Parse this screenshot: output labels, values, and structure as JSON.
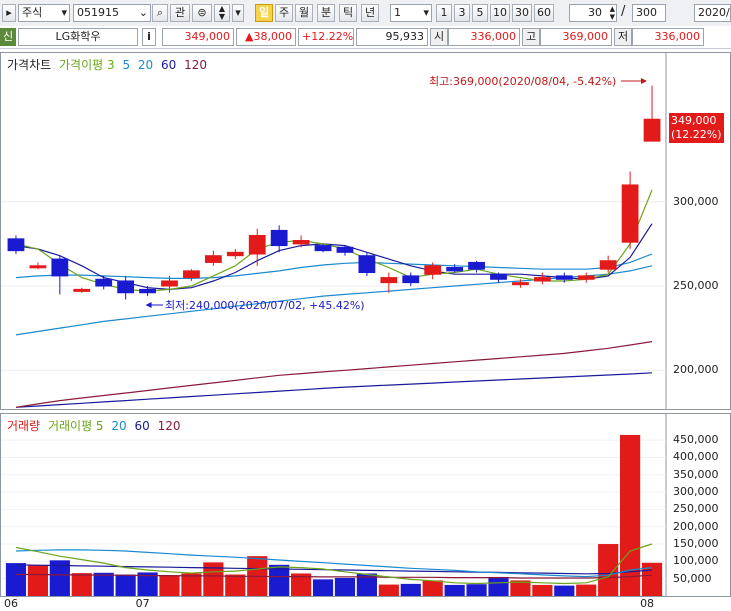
{
  "toolbar": {
    "market": "주식",
    "code": "051915",
    "watch_label": "관",
    "period_selected": "일",
    "periods": [
      "주",
      "월",
      "분",
      "틱",
      "년"
    ],
    "interval": "1",
    "intervals": [
      "1",
      "3",
      "5",
      "10",
      "30",
      "60"
    ],
    "count": "30",
    "total": "300",
    "date": "2020/0"
  },
  "quote": {
    "badge": "신",
    "name": "LG화학우",
    "info": "i",
    "price": "349,000",
    "change": "▲38,000",
    "change_pct": "+12.22%",
    "volume": "95,933",
    "open_label": "시",
    "open": "336,000",
    "high_label": "고",
    "high": "369,000",
    "low_label": "저",
    "low": "336,000"
  },
  "colors": {
    "up": "#e21a1a",
    "down": "#1a1ad0",
    "ma5": "#6aa51a",
    "ma20": "#1a8ad0",
    "ma60": "#1a1a9a",
    "ma120": "#8a1a3a"
  },
  "chart_data": [
    {
      "type": "candlestick",
      "title": "가격차트",
      "legend": [
        {
          "text": "가격이평 3",
          "color": "#6aa51a"
        },
        {
          "text": "5",
          "color": "#1a8ad0"
        },
        {
          "text": "20",
          "color": "#1a8ad0"
        },
        {
          "text": "60",
          "color": "#1a1a9a"
        },
        {
          "text": "120",
          "color": "#8a1a3a"
        }
      ],
      "ylim": [
        177000,
        380000
      ],
      "yticks": [
        200000,
        250000,
        300000
      ],
      "ytick_labels": [
        "200,000",
        "250,000",
        "300,000"
      ],
      "x_labels": [
        {
          "index": 0,
          "text": "06"
        },
        {
          "index": 6,
          "text": "07"
        },
        {
          "index": 29,
          "text": "08"
        }
      ],
      "candles": [
        [
          278000,
          280000,
          269000,
          271000
        ],
        [
          262000,
          264000,
          260000,
          262000
        ],
        [
          266000,
          268000,
          245000,
          256000
        ],
        [
          248000,
          249000,
          246000,
          248000
        ],
        [
          254000,
          256000,
          248000,
          250000
        ],
        [
          253000,
          256000,
          242000,
          246000
        ],
        [
          248000,
          250000,
          244000,
          246000
        ],
        [
          250000,
          256000,
          246000,
          253000
        ],
        [
          255000,
          260000,
          253000,
          259000
        ],
        [
          264000,
          271000,
          262000,
          268000
        ],
        [
          268000,
          272000,
          266000,
          270000
        ],
        [
          269000,
          284000,
          262000,
          280000
        ],
        [
          283000,
          286000,
          270000,
          274000
        ],
        [
          275000,
          280000,
          273000,
          277000
        ],
        [
          274000,
          275000,
          270000,
          271000
        ],
        [
          273000,
          274000,
          268000,
          270000
        ],
        [
          268000,
          270000,
          256000,
          258000
        ],
        [
          252000,
          258000,
          246000,
          255000
        ],
        [
          256000,
          258000,
          250000,
          252000
        ],
        [
          257000,
          264000,
          254000,
          262000
        ],
        [
          261000,
          263000,
          258000,
          259000
        ],
        [
          264000,
          265000,
          258000,
          260000
        ],
        [
          257000,
          258000,
          252000,
          254000
        ],
        [
          251000,
          254000,
          249000,
          252000
        ],
        [
          253000,
          258000,
          251000,
          255000
        ],
        [
          256000,
          258000,
          252000,
          254000
        ],
        [
          254000,
          258000,
          252000,
          256000
        ],
        [
          260000,
          268000,
          258000,
          265000
        ],
        [
          276000,
          318000,
          272000,
          310000
        ],
        [
          336000,
          369000,
          336000,
          349000
        ]
      ],
      "ma3": [
        275000,
        272000,
        263000,
        255000,
        251000,
        248000,
        247000,
        248000,
        250000,
        256000,
        262000,
        272000,
        276000,
        277000,
        275000,
        272000,
        266000,
        261000,
        255000,
        257000,
        258000,
        260000,
        257000,
        255000,
        253000,
        253000,
        254000,
        257000,
        275000,
        307000
      ],
      "ma5": [
        274000,
        272000,
        268000,
        262000,
        255000,
        252000,
        249000,
        248000,
        249000,
        253000,
        258000,
        265000,
        271000,
        274000,
        275000,
        274000,
        270000,
        266000,
        262000,
        259000,
        257000,
        257000,
        257000,
        257000,
        256000,
        255000,
        254000,
        256000,
        267000,
        287000
      ],
      "ma20": [
        255000,
        256000,
        256500,
        256500,
        256000,
        255500,
        255000,
        254500,
        254500,
        255000,
        256000,
        257500,
        259000,
        261000,
        262500,
        263500,
        264000,
        263500,
        263000,
        262500,
        262000,
        261500,
        261000,
        260500,
        260000,
        260000,
        260000,
        261000,
        264000,
        269000
      ],
      "ma60": [
        221000,
        223000,
        225000,
        227000,
        229000,
        230500,
        232000,
        233500,
        235000,
        236500,
        238000,
        239500,
        241000,
        242500,
        244000,
        245000,
        246000,
        247000,
        248000,
        249000,
        250000,
        251000,
        252000,
        253000,
        254000,
        255000,
        256000,
        257000,
        259000,
        262000
      ],
      "ma120": [
        178000,
        180000,
        182000,
        183500,
        185000,
        186500,
        188000,
        189500,
        191000,
        192500,
        194000,
        195500,
        197000,
        198000,
        199000,
        200000,
        201000,
        202000,
        203000,
        204000,
        205000,
        206000,
        207000,
        208000,
        209000,
        210000,
        211500,
        213000,
        215000,
        217000
      ],
      "ma120_b": [
        178000,
        178800,
        179600,
        180400,
        181200,
        182000,
        182800,
        183600,
        184400,
        185200,
        186000,
        186800,
        187600,
        188400,
        189200,
        190000,
        190600,
        191200,
        191800,
        192400,
        193000,
        193600,
        194200,
        194800,
        195400,
        196000,
        196600,
        197200,
        197800,
        198500
      ],
      "annotations": {
        "high": "최고:369,000(2020/08/04, -5.42%)",
        "low": "최저:240,000(2020/07/02, +45.42%)",
        "last_price": "349,000",
        "last_pct": "(12.22%)"
      }
    },
    {
      "type": "bar",
      "title": "거래량",
      "legend": [
        {
          "text": "거래이평 5",
          "color": "#6aa51a"
        },
        {
          "text": "20",
          "color": "#1a8ad0"
        },
        {
          "text": "60",
          "color": "#1a1a9a"
        },
        {
          "text": "120",
          "color": "#8a1a3a"
        }
      ],
      "ylim": [
        0,
        485000
      ],
      "yticks": [
        50000,
        100000,
        150000,
        200000,
        250000,
        300000,
        350000,
        400000,
        450000
      ],
      "ytick_labels": [
        "50,000",
        "100,000",
        "150,000",
        "200,000",
        "250,000",
        "300,000",
        "350,000",
        "400,000",
        "450,000"
      ],
      "volumes": [
        95000,
        88000,
        103000,
        66000,
        67000,
        62000,
        68000,
        58000,
        65000,
        97000,
        62000,
        115000,
        90000,
        65000,
        48000,
        52000,
        65000,
        33000,
        35000,
        45000,
        32000,
        34000,
        55000,
        45000,
        32000,
        30000,
        33000,
        150000,
        465000,
        95933
      ],
      "vma5": [
        140000,
        128000,
        115000,
        105000,
        95000,
        82000,
        75000,
        70000,
        66000,
        70000,
        72000,
        78000,
        84000,
        82000,
        78000,
        70000,
        62000,
        55000,
        48000,
        44000,
        38000,
        36000,
        38000,
        40000,
        38000,
        36000,
        38000,
        55000,
        130000,
        150000
      ],
      "vma20": [
        130000,
        132000,
        133000,
        133000,
        132000,
        130000,
        126000,
        122000,
        118000,
        115000,
        112000,
        108000,
        104000,
        100000,
        96000,
        92000,
        88000,
        84000,
        80000,
        77000,
        74000,
        70000,
        67000,
        64000,
        61000,
        58000,
        56000,
        60000,
        75000,
        82000
      ],
      "vma60": [
        90000,
        89000,
        88000,
        87000,
        86000,
        85000,
        84000,
        83000,
        82000,
        81000,
        80000,
        79000,
        78000,
        77000,
        76000,
        75000,
        74000,
        73000,
        72000,
        71000,
        70000,
        69000,
        68000,
        67000,
        66000,
        65000,
        64000,
        65000,
        70000,
        75000
      ],
      "vma120": [
        62000,
        62000,
        61000,
        61000,
        60000,
        60000,
        59000,
        59000,
        58000,
        58000,
        57000,
        57000,
        56000,
        56000,
        55000,
        55000,
        55000,
        54000,
        54000,
        54000,
        53000,
        53000,
        53000,
        52000,
        52000,
        52000,
        52000,
        53000,
        56000,
        60000
      ]
    }
  ]
}
